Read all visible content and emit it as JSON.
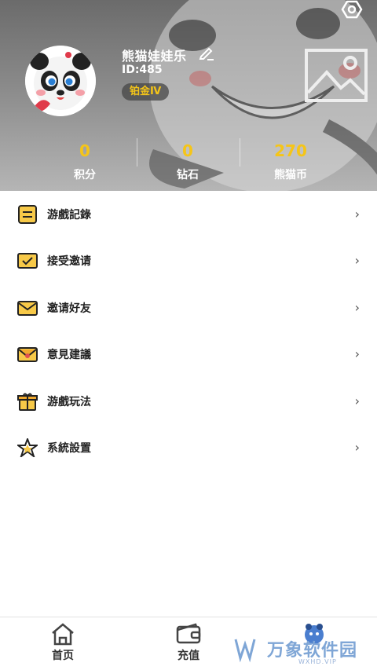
{
  "profile": {
    "username": "熊猫娃娃乐",
    "id_text": "ID:485",
    "rank": "铂金Ⅳ"
  },
  "stats": [
    {
      "value": "0",
      "label": "积分"
    },
    {
      "value": "0",
      "label": "钻石"
    },
    {
      "value": "270",
      "label": "熊猫币"
    }
  ],
  "menu": [
    {
      "label": "游戲記錄",
      "icon": "list-icon"
    },
    {
      "label": "接受邀请",
      "icon": "mail-check-icon"
    },
    {
      "label": "邀请好友",
      "icon": "envelope-icon"
    },
    {
      "label": "意見建議",
      "icon": "feedback-envelope-icon"
    },
    {
      "label": "游戲玩法",
      "icon": "gift-box-icon"
    },
    {
      "label": "系統設置",
      "icon": "star-settings-icon"
    }
  ],
  "chevron": "›",
  "nav": {
    "home": "首页",
    "recharge": "充值"
  },
  "watermark": {
    "text": "万象软件园",
    "sub": "WXHD.VIP"
  },
  "colors": {
    "accent": "#f5c518",
    "icon_yellow": "#f7c948"
  }
}
